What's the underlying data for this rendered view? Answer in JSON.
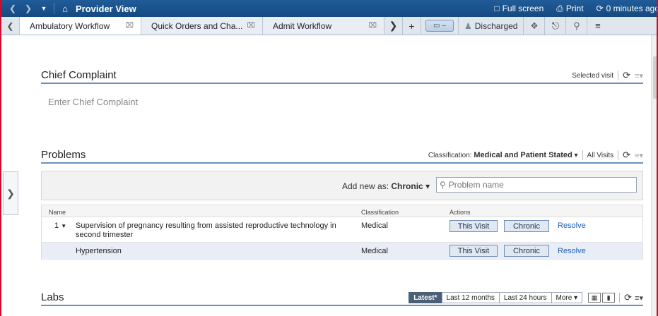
{
  "titlebar": {
    "title": "Provider View",
    "full_screen": "Full screen",
    "print": "Print",
    "refresh_status": "0 minutes ago"
  },
  "tabs": [
    {
      "label": "Ambulatory Workflow"
    },
    {
      "label": "Quick Orders and Cha..."
    },
    {
      "label": "Admit Workflow"
    }
  ],
  "tabbar": {
    "status": "Discharged"
  },
  "chief_complaint": {
    "title": "Chief Complaint",
    "scope": "Selected visit",
    "placeholder": "Enter Chief Complaint"
  },
  "problems": {
    "title": "Problems",
    "classification_label": "Classification:",
    "classification_value": "Medical and Patient Stated",
    "scope": "All Visits",
    "add_new_label": "Add new as:",
    "add_new_value": "Chronic",
    "search_placeholder": "Problem name",
    "columns": {
      "name": "Name",
      "classification": "Classification",
      "actions": "Actions"
    },
    "rows": [
      {
        "num": "1",
        "name": "Supervision of pregnancy resulting from assisted reproductive technology in second trimester",
        "classification": "Medical",
        "this_visit": "This Visit",
        "chronic": "Chronic",
        "resolve": "Resolve"
      },
      {
        "num": "",
        "name": "Hypertension",
        "classification": "Medical",
        "this_visit": "This Visit",
        "chronic": "Chronic",
        "resolve": "Resolve"
      }
    ]
  },
  "labs": {
    "title": "Labs",
    "filters": [
      "Latest*",
      "Last 12 months",
      "Last 24 hours",
      "More"
    ]
  },
  "colors": {
    "titlebar": "#1f5c99",
    "accent": "#6b8fbf",
    "link": "#1a5fb4",
    "frame": "#c8102e"
  }
}
